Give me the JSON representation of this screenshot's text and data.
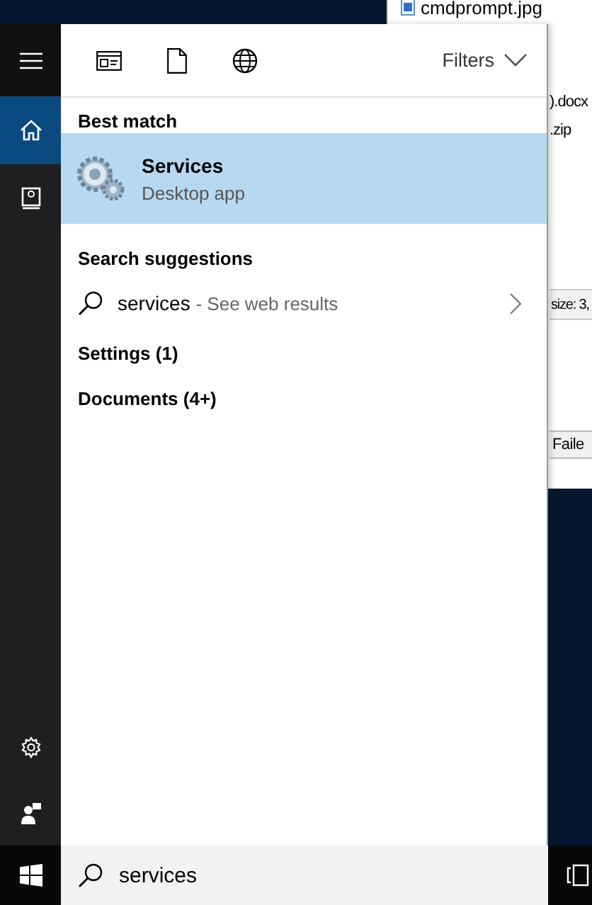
{
  "explorer": {
    "files": [
      {
        "name": "cmdprompt.jpg"
      },
      {
        "name": ").docx"
      },
      {
        "name": ".zip"
      }
    ],
    "status_text": "size: 3,",
    "column_header": "Faile"
  },
  "rail": [
    {
      "kind": "menu",
      "selected": false
    },
    {
      "kind": "home",
      "selected": true
    },
    {
      "kind": "notebook",
      "selected": false
    },
    {
      "kind": "settings",
      "selected": false
    },
    {
      "kind": "feedback",
      "selected": false
    }
  ],
  "toolbar": {
    "scopes": [
      {
        "kind": "apps"
      },
      {
        "kind": "documents"
      },
      {
        "kind": "web"
      }
    ],
    "filters_label": "Filters"
  },
  "best_match": {
    "heading": "Best match",
    "result": {
      "title": "Services",
      "subtitle": "Desktop app",
      "selected": true
    }
  },
  "suggestions": {
    "heading": "Search suggestions",
    "items": [
      {
        "query": "services",
        "hint": "- See web results"
      }
    ]
  },
  "groups": [
    {
      "heading": "Settings (1)"
    },
    {
      "heading": "Documents (4+)"
    }
  ],
  "search_box": {
    "value": "services"
  }
}
